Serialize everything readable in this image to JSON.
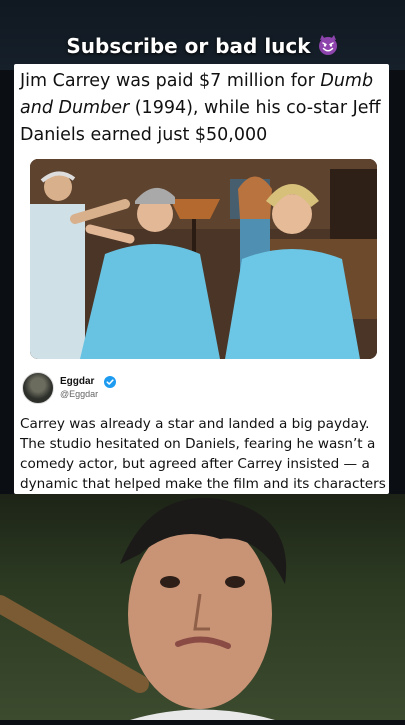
{
  "overlay": {
    "headline": "Subscribe or bad luck",
    "emoji_icon": "smiling-imp-icon"
  },
  "post": {
    "title_part1": "Jim Carrey was paid $7 million for ",
    "title_italic": "Dumb and Dumber",
    "title_part2": " (1994), while his co-star Jeff Daniels earned just $50,000",
    "photo_icon": "movie-still-image",
    "author": {
      "name": "Eggdar",
      "handle": "@Eggdar",
      "verified_icon": "verified-badge-icon"
    },
    "body": "Carrey was already a star and landed a big payday. The studio hesitated on Daniels, fearing he wasn’t a comedy actor, but agreed after Carrey insisted — a dynamic that helped make the film and its characters iconic."
  },
  "colors": {
    "background": "#0b0f14",
    "card": "#ffffff",
    "text": "#111111",
    "handle": "#666666",
    "verified": "#1d9bf0",
    "emoji": "#8e44ad"
  }
}
